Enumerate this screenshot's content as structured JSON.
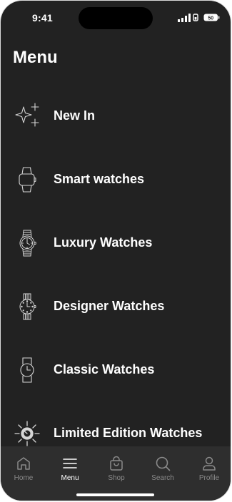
{
  "status": {
    "time": "9:41",
    "battery": "50"
  },
  "page": {
    "title": "Menu"
  },
  "menu": {
    "items": [
      {
        "label": "New In",
        "icon": "sparkle-icon"
      },
      {
        "label": "Smart watches",
        "icon": "smartwatch-icon"
      },
      {
        "label": "Luxury Watches",
        "icon": "luxury-watch-icon"
      },
      {
        "label": "Designer Watches",
        "icon": "designer-watch-icon"
      },
      {
        "label": "Classic Watches",
        "icon": "classic-watch-icon"
      },
      {
        "label": "Limited Edition Watches",
        "icon": "limited-edition-icon"
      }
    ]
  },
  "tabbar": {
    "active": "Menu",
    "tabs": [
      {
        "label": "Home",
        "icon": "home-icon"
      },
      {
        "label": "Menu",
        "icon": "hamburger-icon"
      },
      {
        "label": "Shop",
        "icon": "shopping-bag-icon"
      },
      {
        "label": "Search",
        "icon": "search-icon"
      },
      {
        "label": "Profile",
        "icon": "profile-icon"
      }
    ]
  },
  "colors": {
    "background": "#222222",
    "tabbar": "#2e2e2e",
    "text": "#ffffff",
    "inactive_tab": "#8a8a8a"
  }
}
